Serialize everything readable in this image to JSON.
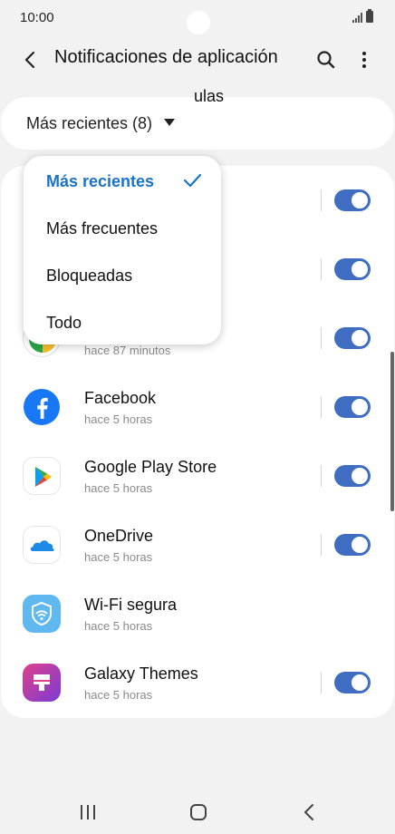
{
  "status": {
    "time": "10:00"
  },
  "header": {
    "title": "Notificaciones de aplicación"
  },
  "filter": {
    "label": "Más recientes (8)"
  },
  "dropdown": {
    "options": [
      {
        "label": "Más recientes",
        "selected": true
      },
      {
        "label": "Más frecuentes",
        "selected": false
      },
      {
        "label": "Bloqueadas",
        "selected": false
      },
      {
        "label": "Todo",
        "selected": false
      }
    ]
  },
  "apps": [
    {
      "name": "",
      "time": "",
      "icon": "hidden-app-icon",
      "enabled": true
    },
    {
      "name": "ulas",
      "time": "",
      "icon": "hidden-app-icon",
      "enabled": true
    },
    {
      "name": "",
      "time": "hace 87 minutos",
      "icon": "chrome-icon",
      "enabled": true
    },
    {
      "name": "Facebook",
      "time": "hace 5 horas",
      "icon": "facebook-icon",
      "enabled": true
    },
    {
      "name": "Google Play Store",
      "time": "hace 5 horas",
      "icon": "play-store-icon",
      "enabled": true
    },
    {
      "name": "OneDrive",
      "time": "hace 5 horas",
      "icon": "onedrive-icon",
      "enabled": true
    },
    {
      "name": "Wi-Fi segura",
      "time": "hace 5 horas",
      "icon": "secure-wifi-icon",
      "enabled": false
    },
    {
      "name": "Galaxy Themes",
      "time": "hace 5 horas",
      "icon": "galaxy-themes-icon",
      "enabled": true
    }
  ],
  "colors": {
    "accent": "#3e6dc2",
    "selected_text": "#1a73c8"
  }
}
